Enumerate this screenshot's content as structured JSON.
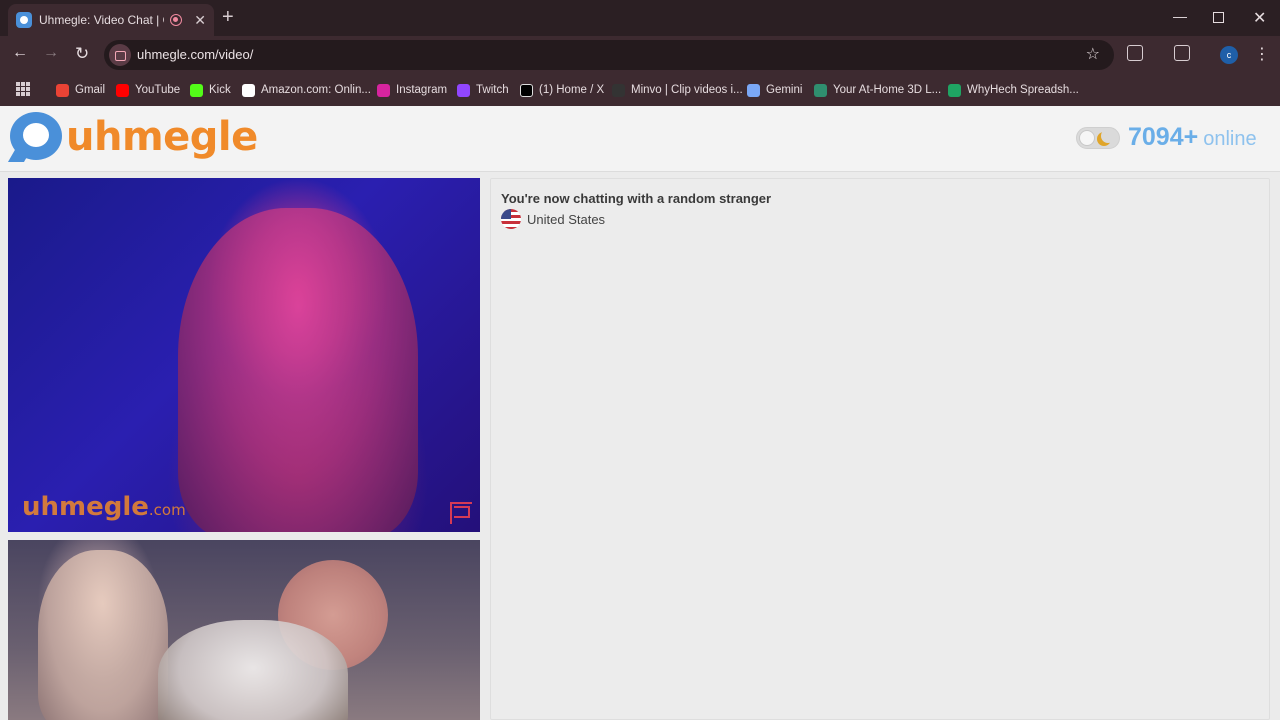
{
  "browser": {
    "tab_title": "Uhmegle: Video Chat | Ome",
    "url": "uhmegle.com/video/",
    "profile_initial": "c",
    "bookmarks": [
      {
        "label": "Gmail",
        "color": "#ea4335"
      },
      {
        "label": "YouTube",
        "color": "#ff0000"
      },
      {
        "label": "Kick",
        "color": "#53fc18"
      },
      {
        "label": "Amazon.com: Onlin...",
        "color": "#ffffff"
      },
      {
        "label": "Instagram",
        "color": "#d6249f"
      },
      {
        "label": "Twitch",
        "color": "#9146ff"
      },
      {
        "label": "(1) Home / X",
        "color": "#000000"
      },
      {
        "label": "Minvo | Clip videos i...",
        "color": "#333333"
      },
      {
        "label": "Gemini",
        "color": "#7aa7f5"
      },
      {
        "label": "Your At-Home 3D L...",
        "color": "#2f8f6f"
      },
      {
        "label": "WhyHech Spreadsh...",
        "color": "#1fa463"
      }
    ]
  },
  "site": {
    "logo_text": "uhmegle",
    "online_count": "7094+",
    "online_label": "online",
    "watermark_main": "uhmegle",
    "watermark_tld": ".com"
  },
  "chat": {
    "status": "You're now chatting with a random stranger",
    "country": "United States"
  },
  "colors": {
    "brand_orange": "#f08a2a",
    "brand_blue": "#4a90d9",
    "online_blue": "#6aaee8"
  }
}
